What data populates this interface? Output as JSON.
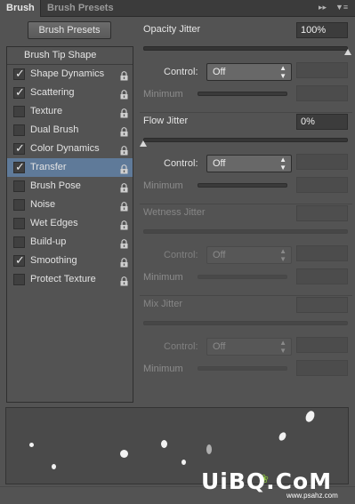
{
  "tabs": [
    {
      "label": "Brush",
      "active": true
    },
    {
      "label": "Brush Presets",
      "active": false
    }
  ],
  "tab_controls": {
    "expand_icon": "double-chevron-right-icon",
    "menu_icon": "panel-menu-icon"
  },
  "brush_presets_button": "Brush Presets",
  "list": {
    "header": "Brush Tip Shape",
    "items": [
      {
        "label": "Shape Dynamics",
        "checked": true,
        "selected": false
      },
      {
        "label": "Scattering",
        "checked": true,
        "selected": false
      },
      {
        "label": "Texture",
        "checked": false,
        "selected": false
      },
      {
        "label": "Dual Brush",
        "checked": false,
        "selected": false
      },
      {
        "label": "Color Dynamics",
        "checked": true,
        "selected": false
      },
      {
        "label": "Transfer",
        "checked": true,
        "selected": true
      },
      {
        "label": "Brush Pose",
        "checked": false,
        "selected": false
      },
      {
        "label": "Noise",
        "checked": false,
        "selected": false
      },
      {
        "label": "Wet Edges",
        "checked": false,
        "selected": false
      },
      {
        "label": "Build-up",
        "checked": false,
        "selected": false
      },
      {
        "label": "Smoothing",
        "checked": true,
        "selected": false
      },
      {
        "label": "Protect Texture",
        "checked": false,
        "selected": false
      }
    ]
  },
  "sections": [
    {
      "title": "Opacity Jitter",
      "value": "100%",
      "level": 1.0,
      "enabled": true,
      "control_label": "Control:",
      "control_value": "Off",
      "minimum_label": "Minimum"
    },
    {
      "title": "Flow Jitter",
      "value": "0%",
      "level": 0.0,
      "enabled": true,
      "control_label": "Control:",
      "control_value": "Off",
      "minimum_label": "Minimum"
    },
    {
      "title": "Wetness Jitter",
      "value": "",
      "level": null,
      "enabled": false,
      "control_label": "Control:",
      "control_value": "Off",
      "minimum_label": "Minimum"
    },
    {
      "title": "Mix Jitter",
      "value": "",
      "level": null,
      "enabled": false,
      "control_label": "Control:",
      "control_value": "Off",
      "minimum_label": "Minimum"
    }
  ],
  "watermark": {
    "text": "UiBQ.CoM",
    "sub": "www.psahz.com"
  },
  "colors": {
    "panel": "#535353",
    "selected": "#5f7a99",
    "field": "#3c3c3c"
  }
}
